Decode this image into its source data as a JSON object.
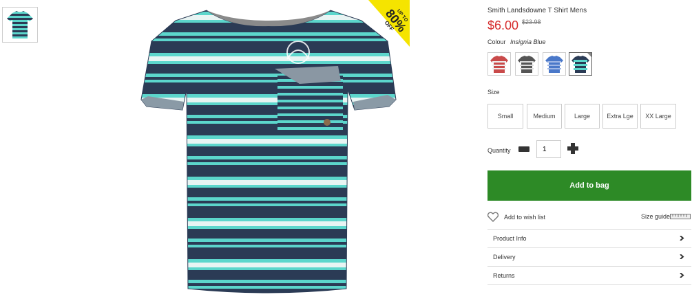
{
  "product": {
    "title": "Smith Landsdowne T Shirt Mens",
    "price": "$6.00",
    "was_price": "$23.98"
  },
  "promo_badge": {
    "line1": "UP TO",
    "line2": "80%",
    "line3": "OFF",
    "color": "#f5e400"
  },
  "colour": {
    "label": "Colour",
    "selected": "Insignia Blue",
    "swatches": [
      "red-stripe",
      "grey-stripe",
      "blue-stripe",
      "teal-stripe"
    ]
  },
  "size": {
    "label": "Size",
    "options": [
      "Small",
      "Medium",
      "Large",
      "Extra Lge",
      "XX Large"
    ]
  },
  "quantity": {
    "label": "Quantity",
    "value": "1"
  },
  "add_to_bag": {
    "label": "Add to bag",
    "color": "#2d8a26"
  },
  "wish_list": {
    "label": "Add to wish list"
  },
  "size_guide": {
    "label": "Size guide"
  },
  "accordion": [
    "Product Info",
    "Delivery",
    "Returns"
  ],
  "colors": {
    "price_red": "#d62e2e",
    "teal": "#5cd6cc",
    "navy": "#2b3b55"
  }
}
